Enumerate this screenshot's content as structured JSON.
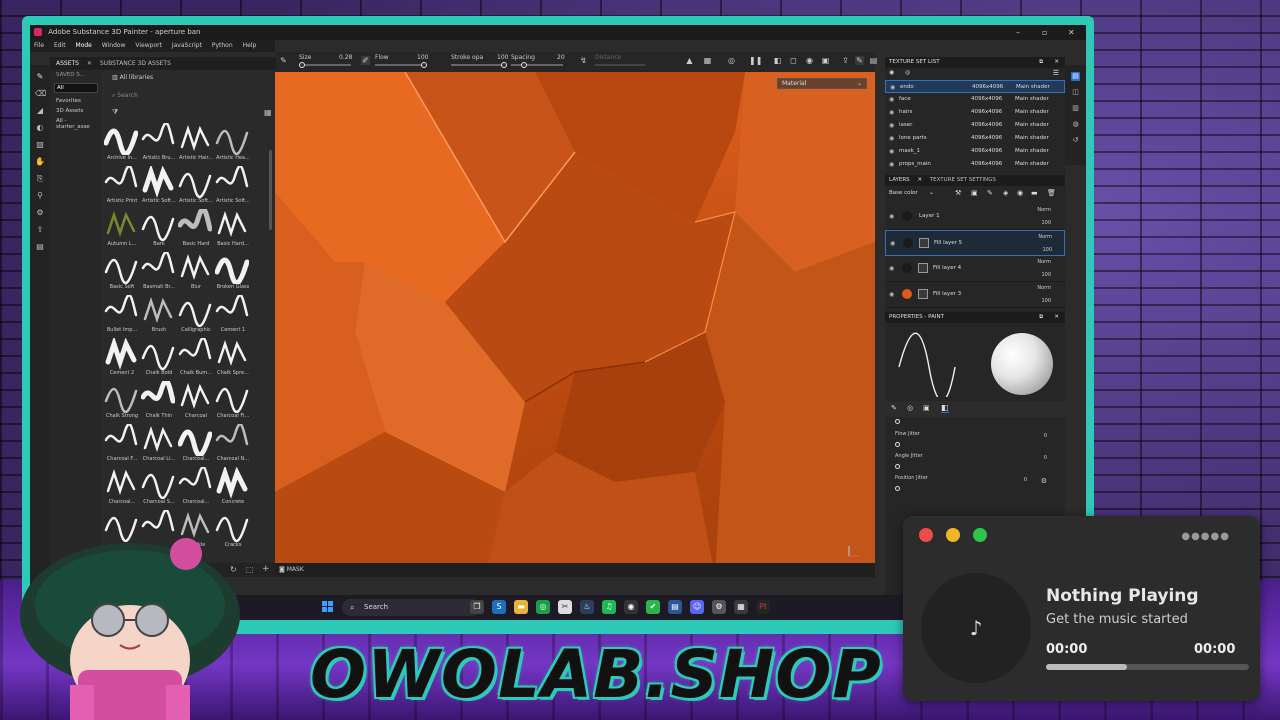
{
  "window": {
    "title": "Adobe Substance 3D Painter - aperture ban"
  },
  "menu": [
    "File",
    "Edit",
    "Mode",
    "Window",
    "Viewport",
    "JavaScript",
    "Python",
    "Help"
  ],
  "toolbar": {
    "size_label": "Size",
    "size_value": "0.28",
    "flow_label": "Flow",
    "flow_value": "100",
    "stroke_label": "Stroke opa",
    "stroke_value": "100",
    "spacing_label": "Spacing",
    "spacing_value": "20",
    "distance_label": "Distance"
  },
  "assets": {
    "tab_assets": "ASSETS",
    "tab_libs": "SUBSTANCE 3D ASSETS",
    "saved_label": "SAVED S...",
    "libraries_label": "All libraries",
    "filter_all": "All",
    "favorites": "Favorites",
    "assets3d": "3D Assets",
    "starter": "All - starter_asse",
    "search_placeholder": "Search",
    "brushes": [
      "Archive In...",
      "Artistic Bru...",
      "Artistic Hair...",
      "Artistic Hea...",
      "Artistic Print",
      "Artistic Soft...",
      "Artistic Soft...",
      "Artistic Soft...",
      "Autumn L...",
      "Bark",
      "Basic Hard",
      "Basic Hard...",
      "Basic Soft",
      "Basmati Br...",
      "Blur",
      "Broken Glass",
      "Bullet Imp...",
      "Brush",
      "Calligraphic",
      "Cement 1",
      "Cement 2",
      "Chalk Bold",
      "Chalk Bum...",
      "Chalk Spre...",
      "Chalk Strong",
      "Chalk Thin",
      "Charcoal",
      "Charcoal Fi...",
      "Charcoal F...",
      "Charcoal Li...",
      "Charcoal...",
      "Charcoal N...",
      "Charcoal...",
      "Charcoal S...",
      "Charcoal...",
      "Concrete",
      "",
      "",
      "Crackle",
      "Cracks"
    ]
  },
  "viewport": {
    "material_label": "Material",
    "mask_label": "MASK"
  },
  "texture_sets": {
    "title": "TEXTURE SET LIST",
    "rows": [
      {
        "name": "endo",
        "res": "4096x4096",
        "shader": "Main shader"
      },
      {
        "name": "face",
        "res": "4096x4096",
        "shader": "Main shader"
      },
      {
        "name": "hairs",
        "res": "4096x4096",
        "shader": "Main shader"
      },
      {
        "name": "laser",
        "res": "4096x4096",
        "shader": "Main shader"
      },
      {
        "name": "lone parts",
        "res": "4096x4096",
        "shader": "Main shader"
      },
      {
        "name": "mask_1",
        "res": "4096x4096",
        "shader": "Main shader"
      },
      {
        "name": "props_main",
        "res": "4096x4096",
        "shader": "Main shader"
      }
    ]
  },
  "layers": {
    "tab_layers": "LAYERS",
    "tab_settings": "TEXTURE SET SETTINGS",
    "channel": "Base color",
    "items": [
      {
        "name": "Layer 1",
        "blend": "Norm",
        "opacity": "100"
      },
      {
        "name": "Fill layer 5",
        "blend": "Norm",
        "opacity": "100"
      },
      {
        "name": "Fill layer 4",
        "blend": "Norm",
        "opacity": "100"
      },
      {
        "name": "Fill layer 3",
        "blend": "Norm",
        "opacity": "100"
      }
    ]
  },
  "properties": {
    "title": "PROPERTIES - PAINT",
    "flow_jitter": "Flow Jitter",
    "flow_jitter_val": "0",
    "angle_jitter": "Angle Jitter",
    "angle_jitter_val": "0",
    "position_jitter": "Position Jitter",
    "position_jitter_val": "0"
  },
  "taskbar": {
    "search_label": "Search"
  },
  "music": {
    "title": "Nothing Playing",
    "subtitle": "Get the music started",
    "time_start": "00:00",
    "time_end": "00:00",
    "progress": 0.4
  },
  "brand": {
    "text": "OWOLAB.SHOP",
    "frame_color": "#2fc9b8",
    "accent_color": "#2a6fd6"
  }
}
